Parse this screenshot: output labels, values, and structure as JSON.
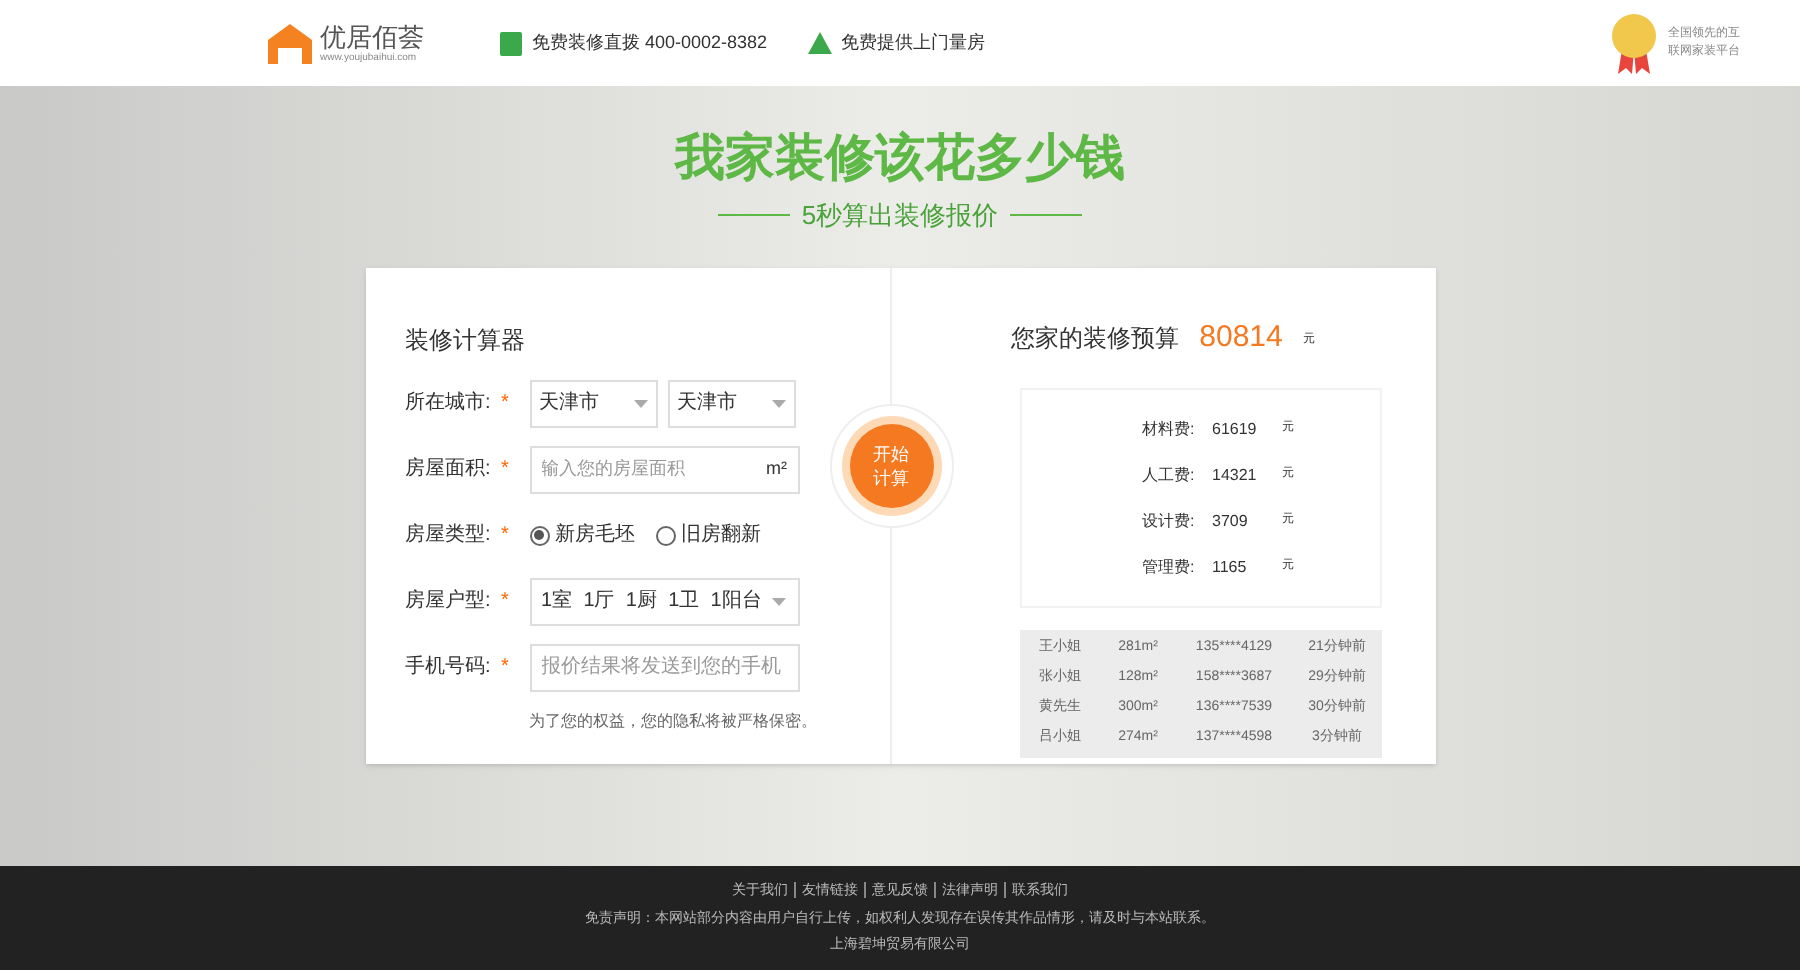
{
  "header": {
    "logo_name": "优居佰荟",
    "logo_url": "www.youjubaihui.com",
    "hotline": "免费装修直拨 400-0002-8382",
    "measure": "免费提供上门量房",
    "badge_lines": [
      "全国领先的互",
      "联网家装平台"
    ]
  },
  "hero": {
    "title": "我家装修该花多少钱",
    "subtitle": "5秒算出装修报价"
  },
  "form": {
    "title": "装修计算器",
    "required_mark": "*",
    "fields": [
      {
        "kind": "selects",
        "label": "所在城市:",
        "values": [
          "天津市",
          "天津市"
        ]
      },
      {
        "kind": "input",
        "label": "房屋面积:",
        "placeholder": "输入您的房屋面积",
        "unit": "m²"
      },
      {
        "kind": "radio",
        "label": "房屋类型:",
        "options": [
          {
            "label": "新房毛坯",
            "selected": true
          },
          {
            "label": "旧房翻新",
            "selected": false
          }
        ]
      },
      {
        "kind": "rooms",
        "label": "房屋户型:",
        "values": [
          "1室",
          "1厅",
          "1厨",
          "1卫",
          "1阳台"
        ]
      },
      {
        "kind": "input",
        "label": "手机号码:",
        "placeholder": "报价结果将发送到您的手机"
      }
    ],
    "note": "为了您的权益，您的隐私将被严格保密。"
  },
  "button": {
    "lines": [
      "开始",
      "计算"
    ]
  },
  "result": {
    "label": "您家的装修预算",
    "total": "80814",
    "unit": "元",
    "items": [
      {
        "label": "材料费:",
        "value": "61619",
        "unit": "元"
      },
      {
        "label": "人工费:",
        "value": "14321",
        "unit": "元"
      },
      {
        "label": "设计费:",
        "value": "3709",
        "unit": "元"
      },
      {
        "label": "管理费:",
        "value": "1165",
        "unit": "元"
      }
    ]
  },
  "recent": [
    [
      "王小姐",
      "281m²",
      "135****4129",
      "21分钟前"
    ],
    [
      "张小姐",
      "128m²",
      "158****3687",
      "29分钟前"
    ],
    [
      "黄先生",
      "300m²",
      "136****7539",
      "30分钟前"
    ],
    [
      "吕小姐",
      "274m²",
      "137****4598",
      "3分钟前"
    ]
  ],
  "footer": {
    "links": [
      "关于我们",
      "友情链接",
      "意见反馈",
      "法律声明",
      "联系我们"
    ],
    "disclaimer": "免责声明：本网站部分内容由用户自行上传，如权利人发现存在误传其作品情形，请及时与本站联系。",
    "company": "上海碧坤贸易有限公司"
  }
}
